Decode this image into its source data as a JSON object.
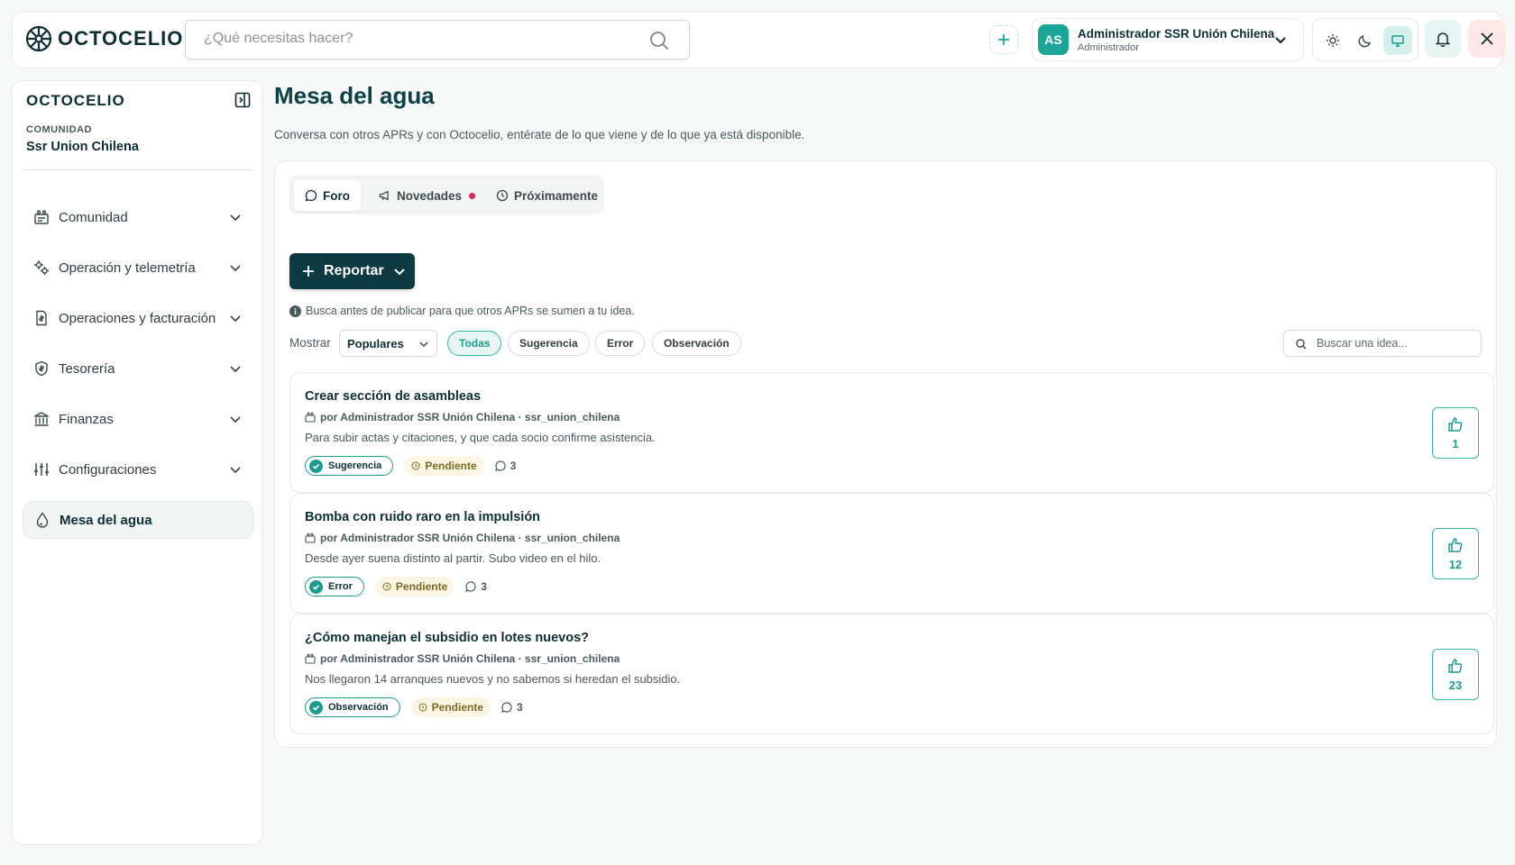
{
  "brand": {
    "name": "OCTOCELIO"
  },
  "topbar": {
    "search_placeholder": "¿Qué necesitas hacer?",
    "user": {
      "initials": "AS",
      "name": "Administrador SSR Unión Chilena",
      "role": "Administrador"
    },
    "accent_color": "#1aa79a"
  },
  "sidebar": {
    "brand": "OCTOCELIO",
    "community_label": "COMUNIDAD",
    "community_name": "Ssr Union Chilena",
    "items": [
      {
        "label": "Comunidad",
        "icon": "community-icon"
      },
      {
        "label": "Operación y telemetría",
        "icon": "gears-icon"
      },
      {
        "label": "Operaciones y facturación",
        "icon": "invoice-icon"
      },
      {
        "label": "Tesorería",
        "icon": "shield-dollar-icon"
      },
      {
        "label": "Finanzas",
        "icon": "bank-icon"
      },
      {
        "label": "Configuraciones",
        "icon": "sliders-icon"
      },
      {
        "label": "Mesa del agua",
        "icon": "water-drop-icon",
        "active": true
      }
    ]
  },
  "page": {
    "title": "Mesa del agua",
    "subtitle": "Conversa con otros APRs y con Octocelio, entérate de lo que viene y de lo que ya está disponible."
  },
  "tabs": [
    {
      "label": "Foro",
      "active": true
    },
    {
      "label": "Novedades",
      "has_dot": true
    },
    {
      "label": "Próximamente"
    }
  ],
  "forum": {
    "report_label": "Reportar",
    "hint": "Busca antes de publicar para que otros APRs se sumen a tu idea.",
    "show_label": "Mostrar",
    "sort_value": "Populares",
    "filters": [
      "Todas",
      "Sugerencia",
      "Error",
      "Observación"
    ],
    "active_filter": "Todas",
    "search_placeholder": "Buscar una idea..."
  },
  "posts": [
    {
      "title": "Crear sección de asambleas",
      "meta": "por Administrador SSR Unión Chilena · ssr_union_chilena",
      "description": "Para subir actas y citaciones, y que cada socio confirme asistencia.",
      "tag": "Sugerencia",
      "status": "Pendiente",
      "comments": "3",
      "votes": "1"
    },
    {
      "title": "Bomba con ruido raro en la impulsión",
      "meta": "por Administrador SSR Unión Chilena · ssr_union_chilena",
      "description": "Desde ayer suena distinto al partir. Subo video en el hilo.",
      "tag": "Error",
      "status": "Pendiente",
      "comments": "3",
      "votes": "12"
    },
    {
      "title": "¿Cómo manejan el subsidio en lotes nuevos?",
      "meta": "por Administrador SSR Unión Chilena · ssr_union_chilena",
      "description": "Nos llegaron 14 arranques nuevos y no sabemos si heredan el subsidio.",
      "tag": "Observación",
      "status": "Pendiente",
      "comments": "3",
      "votes": "23"
    }
  ]
}
